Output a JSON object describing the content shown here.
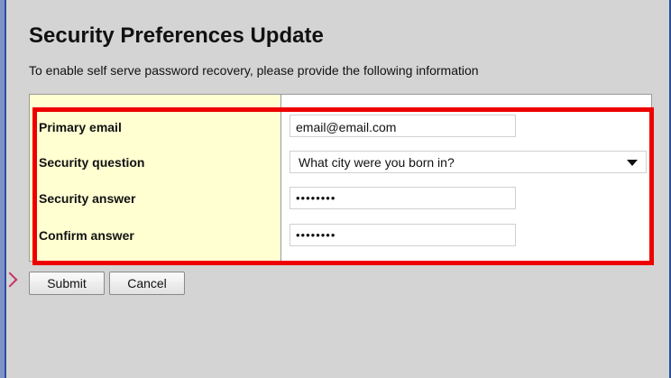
{
  "header": {
    "title": "Security Preferences Update",
    "subtitle": "To enable self serve password recovery, please provide the following information"
  },
  "form": {
    "primary_email": {
      "label": "Primary email",
      "value": "email@email.com"
    },
    "security_question": {
      "label": "Security question",
      "selected": "What city were you born in?"
    },
    "security_answer": {
      "label": "Security answer",
      "masked_value": "••••••••"
    },
    "confirm_answer": {
      "label": "Confirm answer",
      "masked_value": "••••••••"
    }
  },
  "actions": {
    "submit_label": "Submit",
    "cancel_label": "Cancel"
  },
  "colors": {
    "label_column": "#ffffd2",
    "highlight": "#ee0000",
    "page_background": "#d4d4d4"
  },
  "icons": {
    "select_arrow": "chevron-down-icon",
    "pointer": "arrow-right-icon"
  }
}
